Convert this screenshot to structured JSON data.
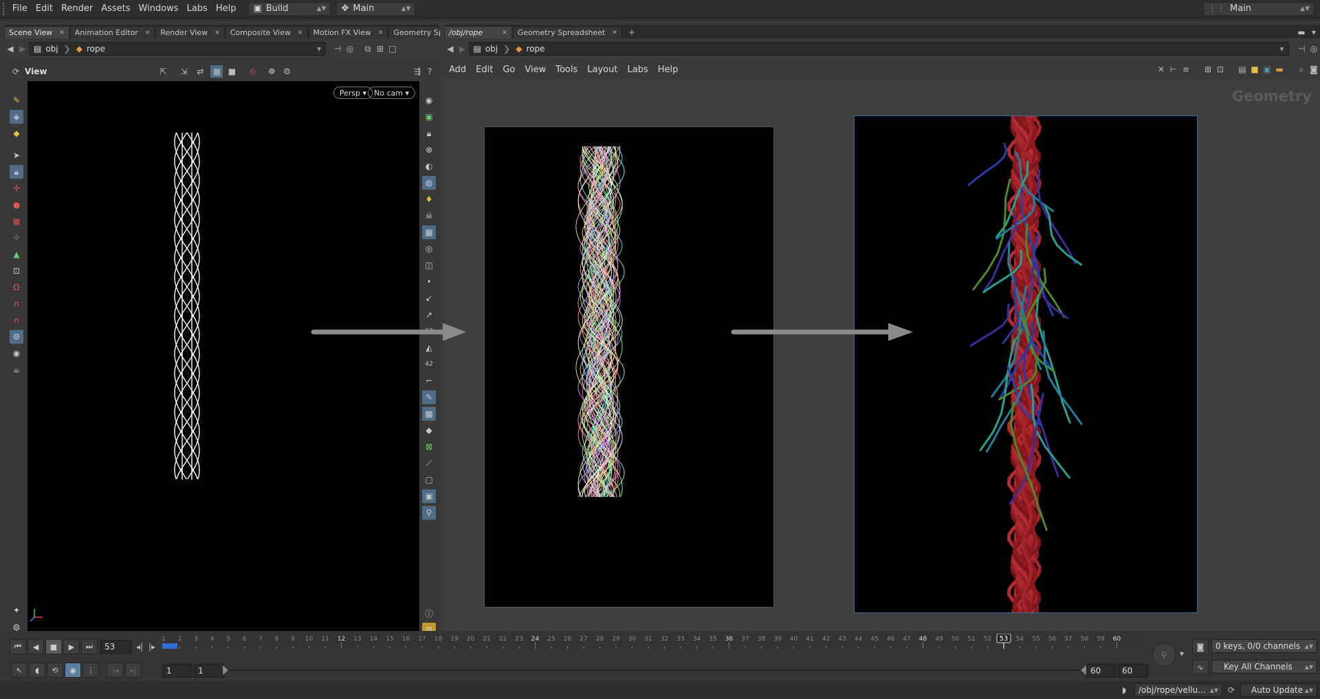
{
  "menu": {
    "items": [
      "File",
      "Edit",
      "Render",
      "Assets",
      "Windows",
      "Labs",
      "Help"
    ],
    "desktop": "Build",
    "context": "Main",
    "right_desk": "Main"
  },
  "left": {
    "tabs": [
      "Scene View",
      "Animation Editor",
      "Render View",
      "Composite View",
      "Motion FX View",
      "Geometry Spre..."
    ],
    "path": {
      "root": "obj",
      "node": "rope"
    },
    "view_label": "View",
    "persp": "Persp ▾",
    "cam": "No cam ▾"
  },
  "right": {
    "tabs": [
      "/obj/rope",
      "Geometry Spreadsheet"
    ],
    "path": {
      "root": "obj",
      "node": "rope"
    },
    "menu": [
      "Add",
      "Edit",
      "Go",
      "View",
      "Tools",
      "Layout",
      "Labs",
      "Help"
    ],
    "watermark": "Geometry"
  },
  "timeline": {
    "frame": "53",
    "start": "1",
    "start2": "1",
    "end": "60",
    "end2": "60",
    "keys": "0 keys, 0/0 channels",
    "key_all": "Key All Channels",
    "ticks_max": 60,
    "current": 53
  },
  "status": {
    "path": "/obj/rope/vellu...",
    "update": "Auto Update"
  },
  "colors": {
    "accent": "#4f6c88",
    "arrow": "#8a8a8a",
    "rope_red": "#a01c24"
  }
}
